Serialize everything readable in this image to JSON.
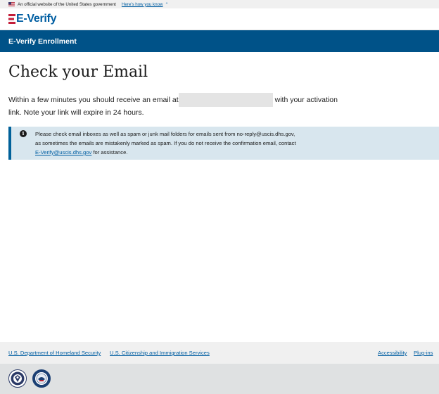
{
  "banner": {
    "text": "An official website of the United States government",
    "link": "Here's how you know",
    "flag_icon": "us-flag-icon",
    "chevron_icon": "chevron-up-icon"
  },
  "logo": {
    "text": "E-Verify",
    "color": "#005ea2",
    "accent_color": "#c41e3a"
  },
  "header": {
    "title": "E-Verify Enrollment",
    "color": "#005288"
  },
  "main": {
    "title": "Check your Email",
    "intro_part1": "Within a few minutes you should receive an email at",
    "intro_part2": "with your activation",
    "intro_line2": "link. Note your link will expire in 24 hours."
  },
  "alert": {
    "icon": "info-icon",
    "line1": "Please check email inboxes as well as spam or junk mail folders for emails sent from no-reply@uscis.dhs.gov,",
    "line2": "as sometimes the emails are mistakenly marked as spam. If you do not receive the confirmation email, contact",
    "link": "E-Verify@uscis.dhs.gov",
    "line3_suffix": "for assistance.",
    "background": "#d8e6ee",
    "border_color": "#00619a"
  },
  "footer": {
    "links": [
      "U.S. Department of Homeland Security",
      "U.S. Citizenship and Immigration Services",
      "Accessibility",
      "Plug-ins"
    ],
    "seals": [
      "dhs-seal-icon",
      "uscis-seal-icon"
    ]
  }
}
